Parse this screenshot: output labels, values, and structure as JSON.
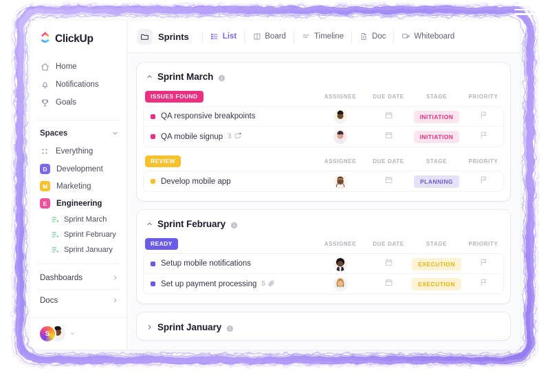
{
  "theme": {
    "accent": "#7b68ee",
    "frame_outer": "#b9a4f5",
    "frame_mid": "#8f7bee",
    "frame_inner": "#a78bfa",
    "pink": "#ec2f7f",
    "yellow": "#fbc02d",
    "purple": "#6b5ce7",
    "green": "#4caf50"
  },
  "hamburger": {
    "name": "menu-icon"
  },
  "sidebar": {
    "logo": {
      "text": "ClickUp",
      "icon": "clickup-logo-icon"
    },
    "nav": [
      {
        "label": "Home",
        "icon": "home-icon"
      },
      {
        "label": "Notifications",
        "icon": "bell-icon"
      },
      {
        "label": "Goals",
        "icon": "trophy-icon"
      }
    ],
    "spaces_header": {
      "label": "Spaces",
      "chevron": "chevron-down-icon"
    },
    "everything": {
      "label": "Everything",
      "icon": "grid-dots-icon"
    },
    "spaces": [
      {
        "label": "Development",
        "initial": "D",
        "color": "#7b68ee",
        "active": false
      },
      {
        "label": "Marketing",
        "initial": "M",
        "color": "#fbc02d",
        "active": false
      },
      {
        "label": "Engineering",
        "initial": "E",
        "color": "#f2509a",
        "active": true
      }
    ],
    "sprints": [
      {
        "label": "Sprint  March",
        "icon": "list-icon"
      },
      {
        "label": "Sprint  February",
        "icon": "list-icon"
      },
      {
        "label": "Sprint January",
        "icon": "list-icon"
      }
    ],
    "footer_items": [
      {
        "label": "Dashboards",
        "chevron": "chevron-right-icon"
      },
      {
        "label": "Docs",
        "chevron": "chevron-right-icon"
      }
    ],
    "user": {
      "initial": "S",
      "caret": "chevron-down-icon"
    }
  },
  "topbar": {
    "folder_icon": "folder-icon",
    "title": "Sprints",
    "tabs": [
      {
        "label": "List",
        "icon": "list-view-icon",
        "active": true
      },
      {
        "label": "Board",
        "icon": "board-view-icon",
        "active": false
      },
      {
        "label": "Timeline",
        "icon": "timeline-view-icon",
        "active": false
      },
      {
        "label": "Doc",
        "icon": "doc-view-icon",
        "active": false
      },
      {
        "label": "Whiteboard",
        "icon": "whiteboard-view-icon",
        "active": false
      }
    ]
  },
  "columns": [
    "ASSIGNEE",
    "DUE DATE",
    "STAGE",
    "PRIORITY"
  ],
  "sprints": [
    {
      "name": "Sprint March",
      "collapsed": false,
      "caret": "chevron-up-icon",
      "info": "info-icon",
      "groups": [
        {
          "status": "ISSUES FOUND",
          "status_bg": "#ec2f7f",
          "tasks": [
            {
              "name": "QA responsive breakpoints",
              "dot": "#ec2f7f",
              "meta": null,
              "meta_icon": null,
              "assignee_skin": "#6b4a30",
              "assignee_bg": "#fdf6e6",
              "assignee_hair": "#241610",
              "due": "calendar-icon",
              "stage": "INITIATION",
              "stage_fg": "#ec2f7f",
              "stage_bg": "#fde4ee",
              "priority": "flag-icon"
            },
            {
              "name": "QA mobile signup",
              "dot": "#ec2f7f",
              "meta": "3",
              "meta_icon": "subtask-icon",
              "assignee_skin": "#d7a58c",
              "assignee_bg": "#fbeaf2",
              "assignee_hair": "#3a2a33",
              "due": "calendar-icon",
              "stage": "INITIATION",
              "stage_fg": "#ec2f7f",
              "stage_bg": "#fde4ee",
              "priority": "flag-icon"
            }
          ]
        },
        {
          "status": "REVIEW",
          "status_bg": "#fbc02d",
          "tasks": [
            {
              "name": "Develop mobile app",
              "dot": "#fbc02d",
              "meta": null,
              "meta_icon": null,
              "assignee_skin": "#e6b596",
              "assignee_bg": "#fdf3ec",
              "assignee_hair": "#5e3a22",
              "due": "calendar-icon",
              "stage": "PLANNING",
              "stage_fg": "#6b5ce7",
              "stage_bg": "#e4e1fd",
              "priority": "flag-icon"
            }
          ]
        }
      ]
    },
    {
      "name": "Sprint February",
      "collapsed": false,
      "caret": "chevron-up-icon",
      "info": "info-icon",
      "groups": [
        {
          "status": "READY",
          "status_bg": "#6b5ce7",
          "tasks": [
            {
              "name": "Setup mobile notifications",
              "dot": "#6b5ce7",
              "meta": null,
              "meta_icon": null,
              "assignee_skin": "#6a4530",
              "assignee_bg": "#f3f0ee",
              "assignee_hair": "#161016",
              "due": "calendar-icon",
              "stage": "EXECUTION",
              "stage_fg": "#eab308",
              "stage_bg": "#fdf3d4",
              "priority": "flag-icon"
            },
            {
              "name": "Set up payment processing",
              "dot": "#6b5ce7",
              "meta": "5",
              "meta_icon": "attachment-icon",
              "assignee_skin": "#e8b894",
              "assignee_bg": "#eef3fb",
              "assignee_hair": "#c98a3c",
              "due": "calendar-icon",
              "stage": "EXECUTION",
              "stage_fg": "#eab308",
              "stage_bg": "#fdf3d4",
              "priority": "flag-icon"
            }
          ]
        }
      ]
    },
    {
      "name": "Sprint January",
      "collapsed": true,
      "caret": "chevron-right-icon",
      "info": "info-icon",
      "groups": []
    }
  ]
}
